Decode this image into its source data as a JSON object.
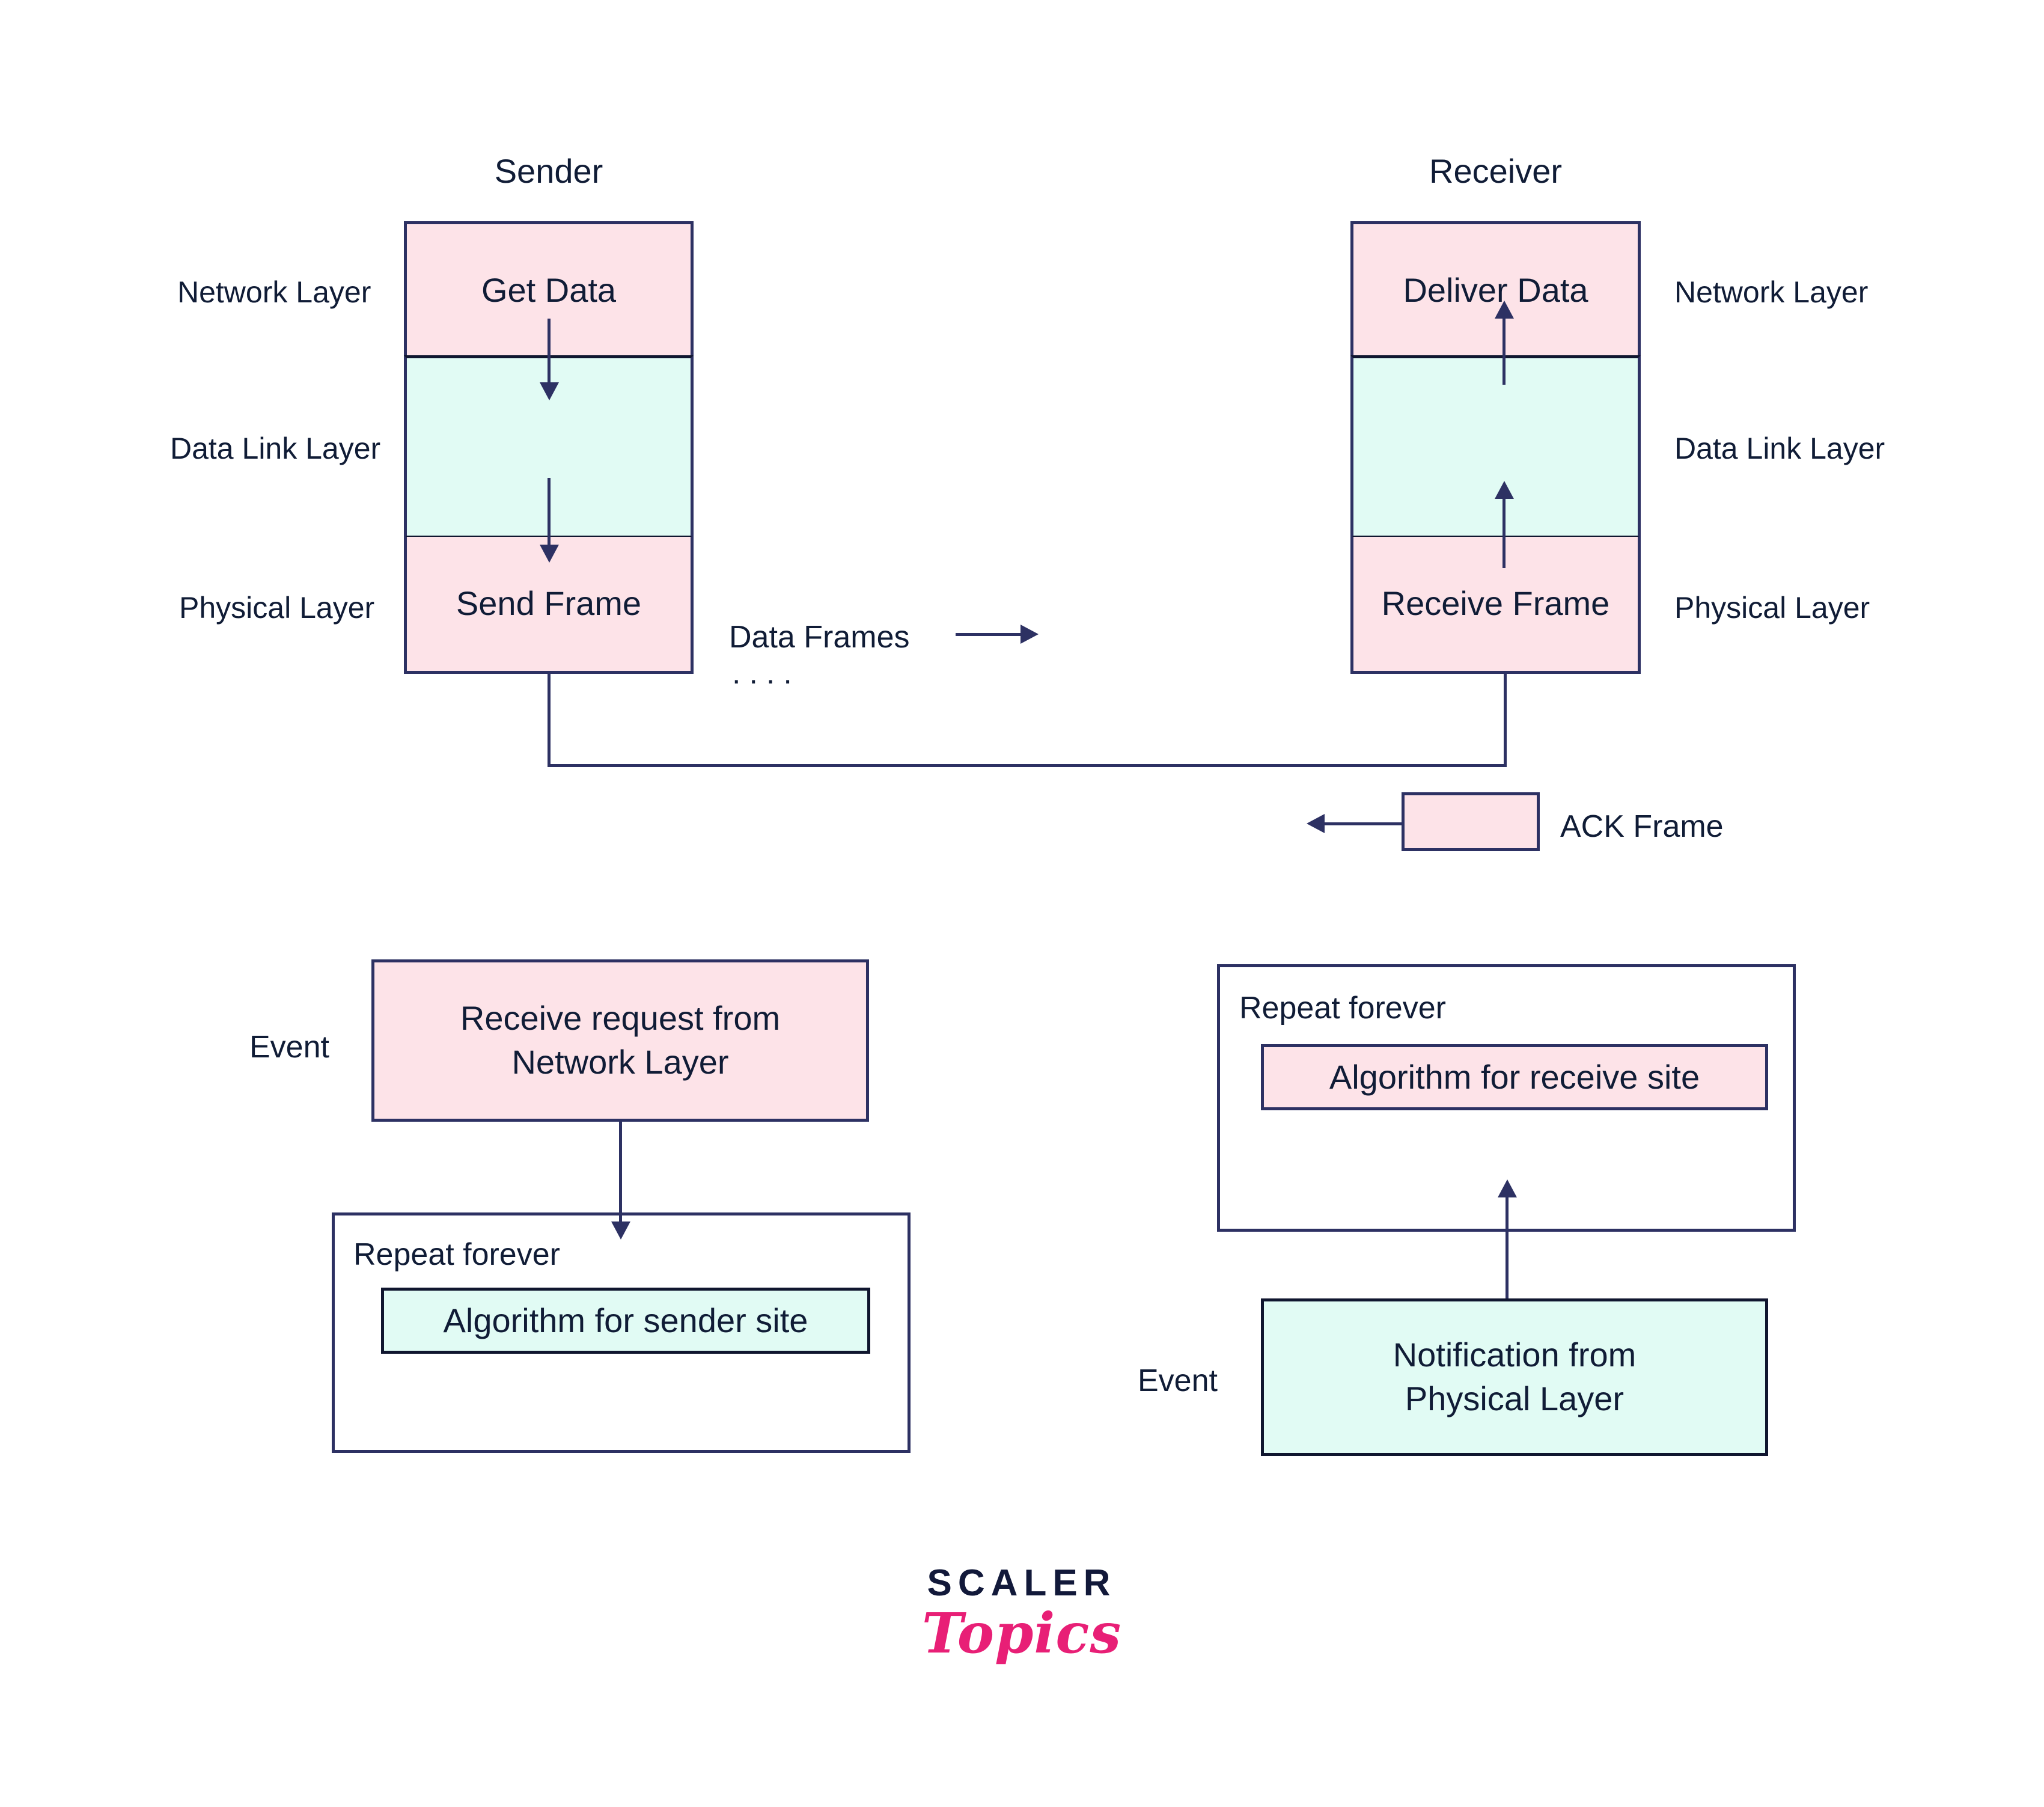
{
  "diagram": {
    "title_sender": "Sender",
    "title_receiver": "Receiver",
    "colors": {
      "stroke": "#2d3163",
      "pink_fill": "#fde3e8",
      "mint_fill": "#e1fbf4",
      "text": "#101c36",
      "logo_pink": "#e81f76",
      "logo_dark": "#12193a",
      "background": "#ffffff"
    }
  },
  "sender_stack": {
    "layer_labels": [
      "Network Layer",
      "Data Link Layer",
      "Physical Layer"
    ],
    "cells": [
      {
        "text": "Get Data",
        "fill": "pink"
      },
      {
        "text": "",
        "fill": "mint"
      },
      {
        "text": "Send Frame",
        "fill": "pink"
      }
    ]
  },
  "receiver_stack": {
    "layer_labels": [
      "Network Layer",
      "Data Link Layer",
      "Physical Layer"
    ],
    "cells": [
      {
        "text": "Deliver Data",
        "fill": "pink"
      },
      {
        "text": "",
        "fill": "mint"
      },
      {
        "text": "Receive Frame",
        "fill": "pink"
      }
    ]
  },
  "channel": {
    "data_frames_label": "Data Frames",
    "ellipsis": "....",
    "ack_label": "ACK Frame"
  },
  "sender_flow": {
    "event_label": "Event",
    "event_box_line1": "Receive request from",
    "event_box_line2": "Network Layer",
    "repeat_label": "Repeat forever",
    "algorithm_box": "Algorithm for sender site"
  },
  "receiver_flow": {
    "event_label": "Event",
    "event_box_line1": "Notification from",
    "event_box_line2": "Physical Layer",
    "repeat_label": "Repeat forever",
    "algorithm_box": "Algorithm for receive site"
  },
  "logo": {
    "word_mark": "SCALER",
    "script_mark": "Topics"
  }
}
